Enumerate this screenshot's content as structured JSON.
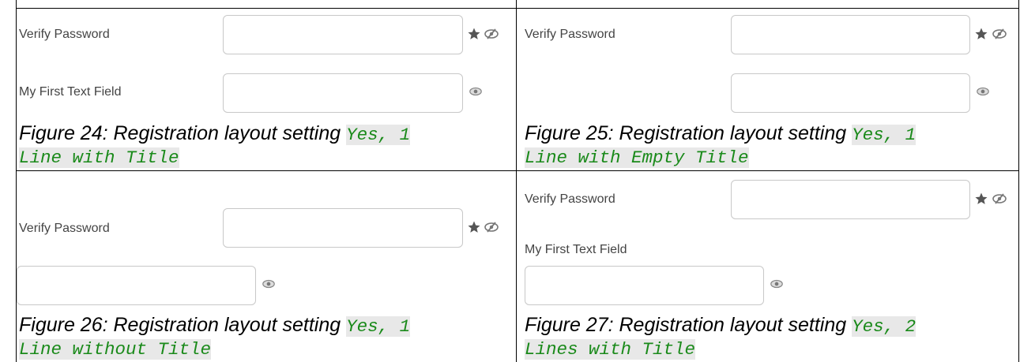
{
  "cells": [
    {
      "labels": {
        "verify": "Verify Password",
        "first": "My First Text Field"
      },
      "caption": {
        "prefix": "Figure 24: Registration layout setting ",
        "code_line1": "Yes, 1",
        "code_line2": "Line with Title"
      }
    },
    {
      "labels": {
        "verify": "Verify Password"
      },
      "caption": {
        "prefix": "Figure 25: Registration layout setting ",
        "code_line1": "Yes, 1",
        "code_line2": "Line with Empty Title"
      }
    },
    {
      "labels": {
        "verify": "Verify Password"
      },
      "caption": {
        "prefix": "Figure 26: Registration layout setting ",
        "code_line1": "Yes, 1",
        "code_line2": "Line without Title"
      }
    },
    {
      "labels": {
        "verify": "Verify Password",
        "first": "My First Text Field"
      },
      "caption": {
        "prefix": "Figure 27: Registration layout setting ",
        "code_line1": "Yes, 2",
        "code_line2": "Lines with Title"
      }
    }
  ],
  "icons": {
    "required": "star-icon",
    "hidden": "eye-slash-icon",
    "show": "eye-icon"
  },
  "colors": {
    "code_text": "#1a8a1a",
    "code_bg": "#e8e8e8",
    "label_text": "#444444",
    "field_border": "#c8c8c8"
  }
}
